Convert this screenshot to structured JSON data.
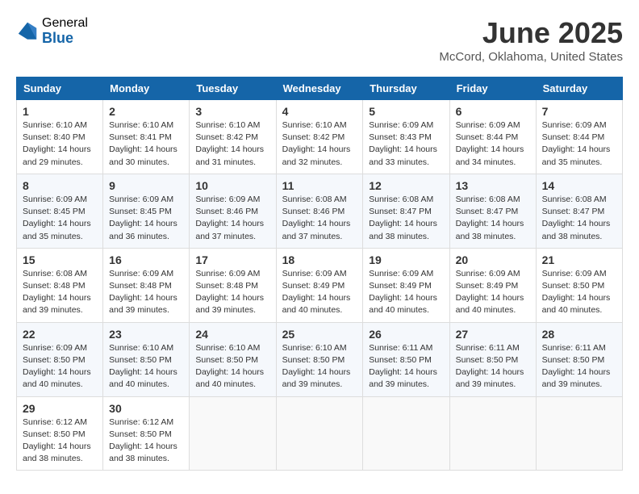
{
  "header": {
    "logo_general": "General",
    "logo_blue": "Blue",
    "month_title": "June 2025",
    "location": "McCord, Oklahoma, United States"
  },
  "days_of_week": [
    "Sunday",
    "Monday",
    "Tuesday",
    "Wednesday",
    "Thursday",
    "Friday",
    "Saturday"
  ],
  "weeks": [
    [
      {
        "day": "1",
        "sunrise": "Sunrise: 6:10 AM",
        "sunset": "Sunset: 8:40 PM",
        "daylight": "Daylight: 14 hours and 29 minutes."
      },
      {
        "day": "2",
        "sunrise": "Sunrise: 6:10 AM",
        "sunset": "Sunset: 8:41 PM",
        "daylight": "Daylight: 14 hours and 30 minutes."
      },
      {
        "day": "3",
        "sunrise": "Sunrise: 6:10 AM",
        "sunset": "Sunset: 8:42 PM",
        "daylight": "Daylight: 14 hours and 31 minutes."
      },
      {
        "day": "4",
        "sunrise": "Sunrise: 6:10 AM",
        "sunset": "Sunset: 8:42 PM",
        "daylight": "Daylight: 14 hours and 32 minutes."
      },
      {
        "day": "5",
        "sunrise": "Sunrise: 6:09 AM",
        "sunset": "Sunset: 8:43 PM",
        "daylight": "Daylight: 14 hours and 33 minutes."
      },
      {
        "day": "6",
        "sunrise": "Sunrise: 6:09 AM",
        "sunset": "Sunset: 8:44 PM",
        "daylight": "Daylight: 14 hours and 34 minutes."
      },
      {
        "day": "7",
        "sunrise": "Sunrise: 6:09 AM",
        "sunset": "Sunset: 8:44 PM",
        "daylight": "Daylight: 14 hours and 35 minutes."
      }
    ],
    [
      {
        "day": "8",
        "sunrise": "Sunrise: 6:09 AM",
        "sunset": "Sunset: 8:45 PM",
        "daylight": "Daylight: 14 hours and 35 minutes."
      },
      {
        "day": "9",
        "sunrise": "Sunrise: 6:09 AM",
        "sunset": "Sunset: 8:45 PM",
        "daylight": "Daylight: 14 hours and 36 minutes."
      },
      {
        "day": "10",
        "sunrise": "Sunrise: 6:09 AM",
        "sunset": "Sunset: 8:46 PM",
        "daylight": "Daylight: 14 hours and 37 minutes."
      },
      {
        "day": "11",
        "sunrise": "Sunrise: 6:08 AM",
        "sunset": "Sunset: 8:46 PM",
        "daylight": "Daylight: 14 hours and 37 minutes."
      },
      {
        "day": "12",
        "sunrise": "Sunrise: 6:08 AM",
        "sunset": "Sunset: 8:47 PM",
        "daylight": "Daylight: 14 hours and 38 minutes."
      },
      {
        "day": "13",
        "sunrise": "Sunrise: 6:08 AM",
        "sunset": "Sunset: 8:47 PM",
        "daylight": "Daylight: 14 hours and 38 minutes."
      },
      {
        "day": "14",
        "sunrise": "Sunrise: 6:08 AM",
        "sunset": "Sunset: 8:47 PM",
        "daylight": "Daylight: 14 hours and 38 minutes."
      }
    ],
    [
      {
        "day": "15",
        "sunrise": "Sunrise: 6:08 AM",
        "sunset": "Sunset: 8:48 PM",
        "daylight": "Daylight: 14 hours and 39 minutes."
      },
      {
        "day": "16",
        "sunrise": "Sunrise: 6:09 AM",
        "sunset": "Sunset: 8:48 PM",
        "daylight": "Daylight: 14 hours and 39 minutes."
      },
      {
        "day": "17",
        "sunrise": "Sunrise: 6:09 AM",
        "sunset": "Sunset: 8:48 PM",
        "daylight": "Daylight: 14 hours and 39 minutes."
      },
      {
        "day": "18",
        "sunrise": "Sunrise: 6:09 AM",
        "sunset": "Sunset: 8:49 PM",
        "daylight": "Daylight: 14 hours and 40 minutes."
      },
      {
        "day": "19",
        "sunrise": "Sunrise: 6:09 AM",
        "sunset": "Sunset: 8:49 PM",
        "daylight": "Daylight: 14 hours and 40 minutes."
      },
      {
        "day": "20",
        "sunrise": "Sunrise: 6:09 AM",
        "sunset": "Sunset: 8:49 PM",
        "daylight": "Daylight: 14 hours and 40 minutes."
      },
      {
        "day": "21",
        "sunrise": "Sunrise: 6:09 AM",
        "sunset": "Sunset: 8:50 PM",
        "daylight": "Daylight: 14 hours and 40 minutes."
      }
    ],
    [
      {
        "day": "22",
        "sunrise": "Sunrise: 6:09 AM",
        "sunset": "Sunset: 8:50 PM",
        "daylight": "Daylight: 14 hours and 40 minutes."
      },
      {
        "day": "23",
        "sunrise": "Sunrise: 6:10 AM",
        "sunset": "Sunset: 8:50 PM",
        "daylight": "Daylight: 14 hours and 40 minutes."
      },
      {
        "day": "24",
        "sunrise": "Sunrise: 6:10 AM",
        "sunset": "Sunset: 8:50 PM",
        "daylight": "Daylight: 14 hours and 40 minutes."
      },
      {
        "day": "25",
        "sunrise": "Sunrise: 6:10 AM",
        "sunset": "Sunset: 8:50 PM",
        "daylight": "Daylight: 14 hours and 39 minutes."
      },
      {
        "day": "26",
        "sunrise": "Sunrise: 6:11 AM",
        "sunset": "Sunset: 8:50 PM",
        "daylight": "Daylight: 14 hours and 39 minutes."
      },
      {
        "day": "27",
        "sunrise": "Sunrise: 6:11 AM",
        "sunset": "Sunset: 8:50 PM",
        "daylight": "Daylight: 14 hours and 39 minutes."
      },
      {
        "day": "28",
        "sunrise": "Sunrise: 6:11 AM",
        "sunset": "Sunset: 8:50 PM",
        "daylight": "Daylight: 14 hours and 39 minutes."
      }
    ],
    [
      {
        "day": "29",
        "sunrise": "Sunrise: 6:12 AM",
        "sunset": "Sunset: 8:50 PM",
        "daylight": "Daylight: 14 hours and 38 minutes."
      },
      {
        "day": "30",
        "sunrise": "Sunrise: 6:12 AM",
        "sunset": "Sunset: 8:50 PM",
        "daylight": "Daylight: 14 hours and 38 minutes."
      },
      null,
      null,
      null,
      null,
      null
    ]
  ]
}
